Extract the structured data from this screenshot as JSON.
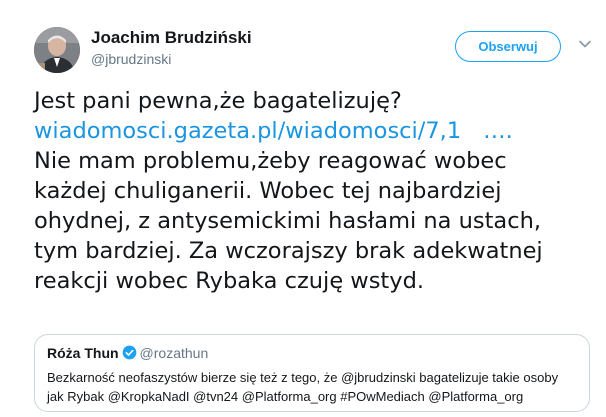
{
  "author": {
    "name": "Joachim Brudziński",
    "handle": "@jbrudzinski"
  },
  "follow_label": "Obserwuj",
  "tweet": {
    "line1": "Jest pani pewna,że bagatelizuję?",
    "link_text": "wiadomosci.gazeta.pl/wiadomosci/7,1",
    "link_ellipsis": "….",
    "line3": "Nie mam problemu,żeby reagować wobec",
    "line4": "każdej chuliganerii. Wobec tej najbardziej",
    "line5": "ohydnej, z antysemickimi hasłami na ustach,",
    "line6": "tym bardziej. Za wczorajszy brak adekwatnej",
    "line7": "reakcji wobec Rybaka czuję wstyd."
  },
  "quote": {
    "name": "Róża Thun",
    "handle": "@rozathun",
    "line1": "Bezkarność neofaszystów bierze się też z tego, że @jbrudzinski bagatelizuje takie osoby",
    "line2": "jak Rybak @KropkaNadI @tvn24 @Platforma_org #POwMediach @Platforma_org"
  },
  "colors": {
    "accent": "#1da1f2",
    "link": "#1b95e0",
    "muted": "#657786",
    "border": "#ccd6dd",
    "text": "#14171a"
  },
  "icons": {
    "avatar": "profile-photo",
    "caret": "chevron-down-icon",
    "verified": "verified-badge-icon"
  }
}
